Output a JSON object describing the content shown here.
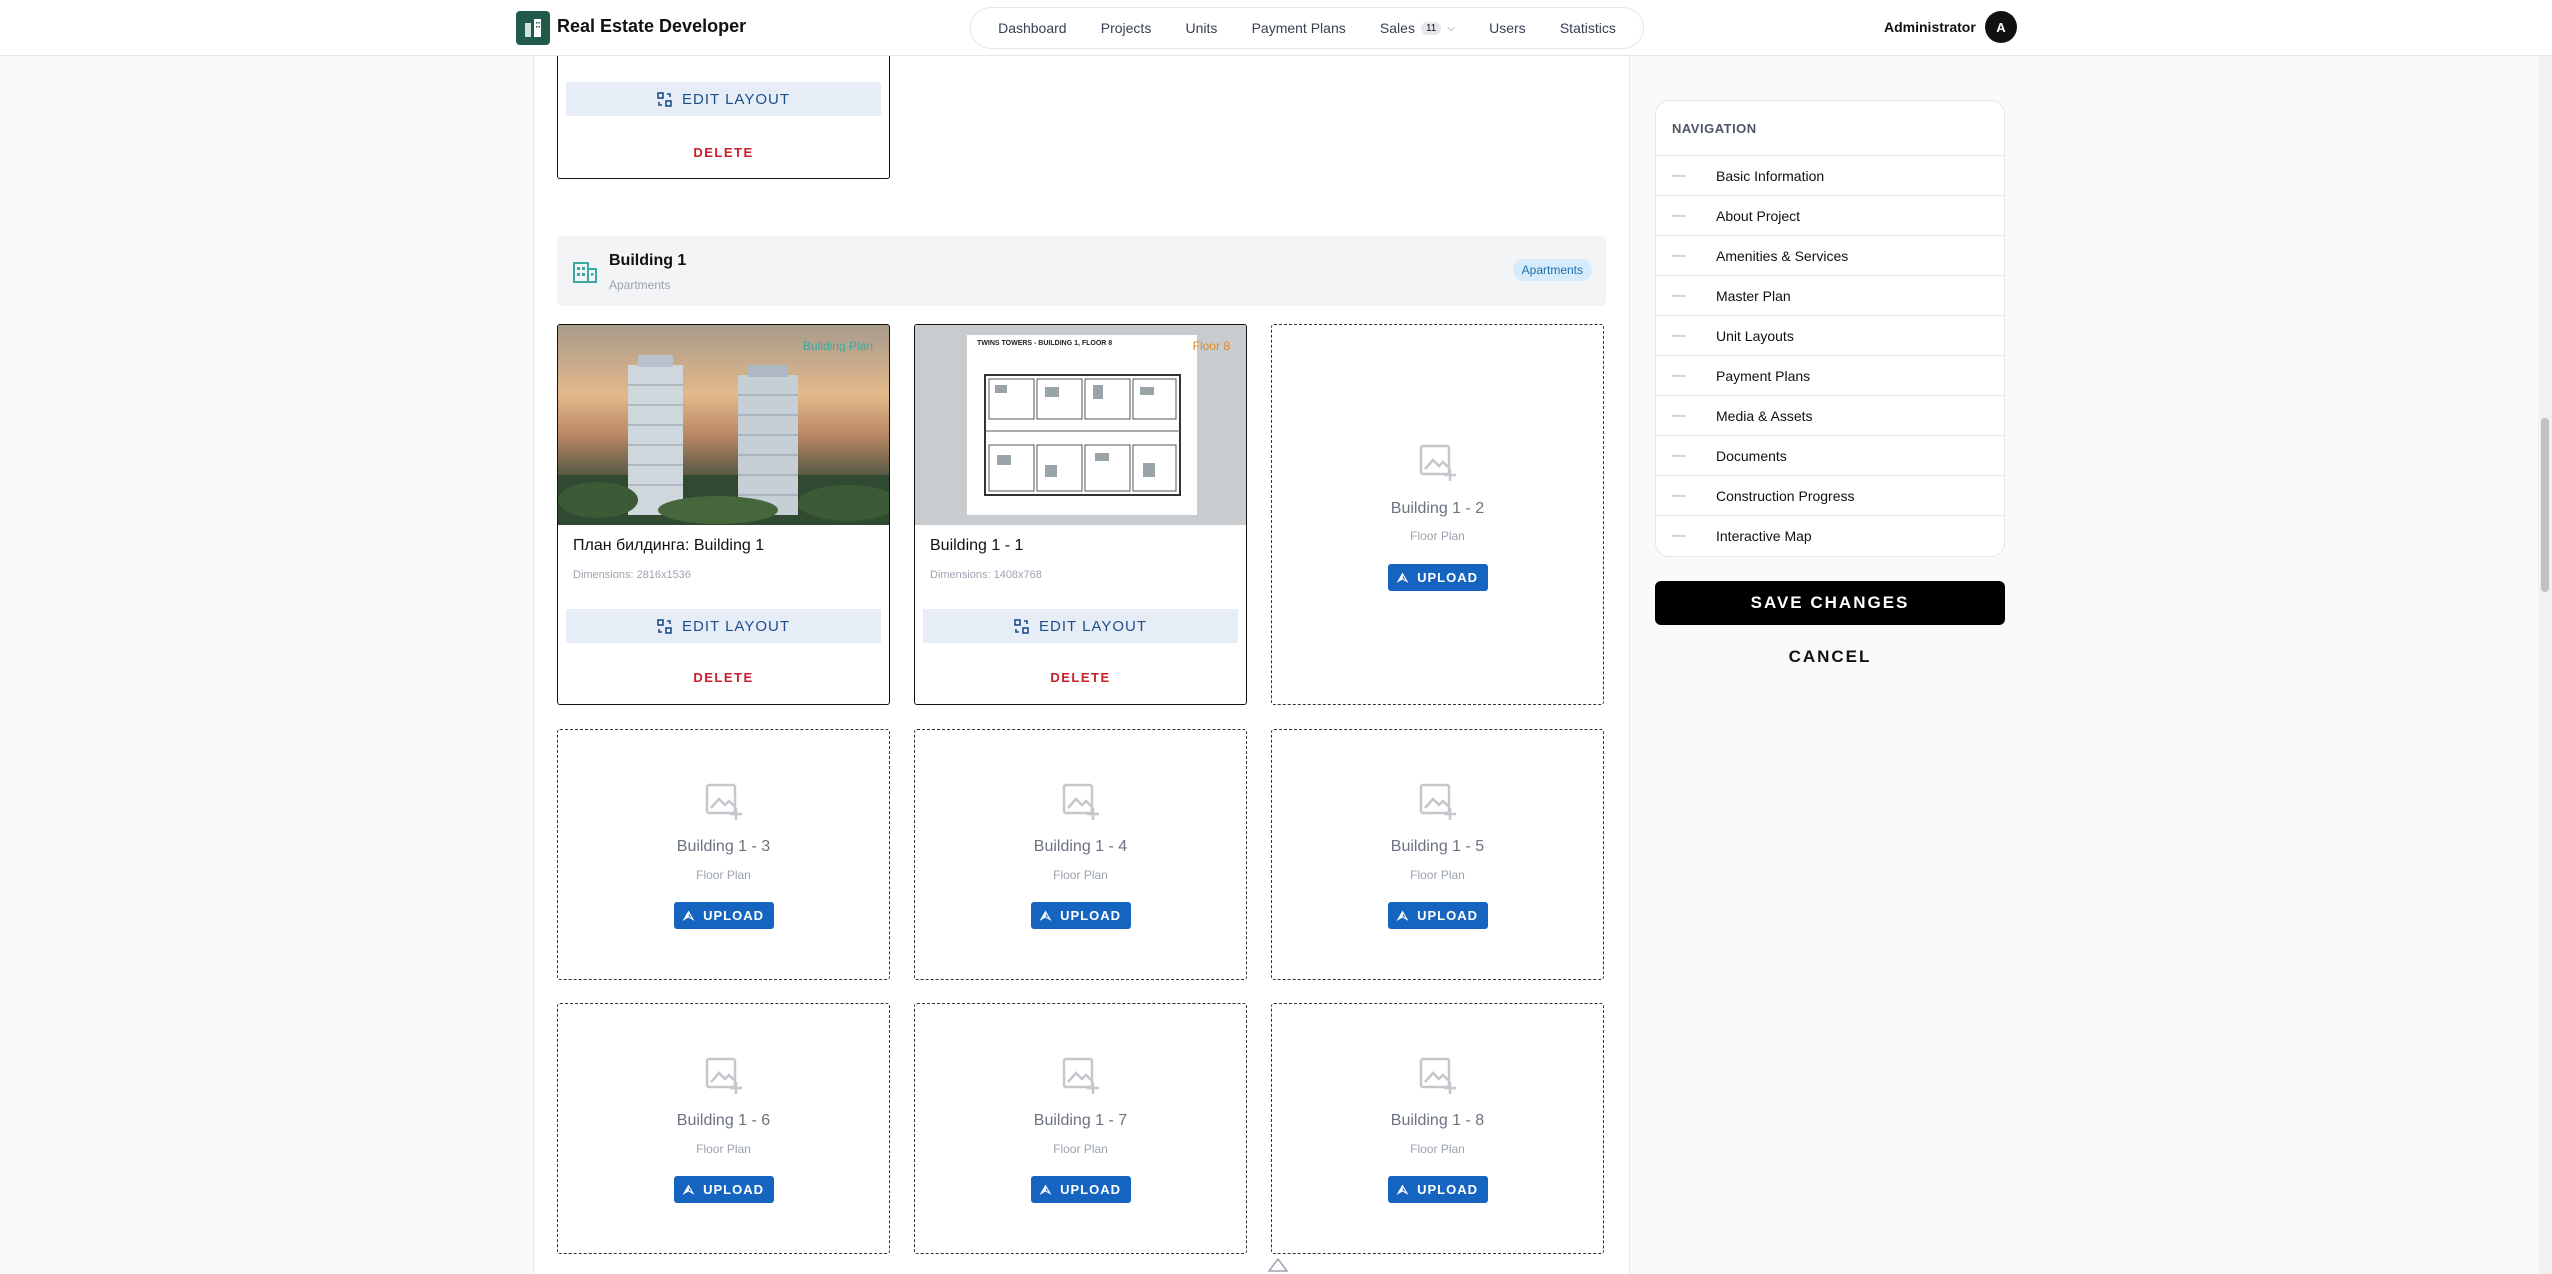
{
  "header": {
    "app_title": "Real Estate Developer",
    "nav": [
      {
        "label": "Dashboard"
      },
      {
        "label": "Projects"
      },
      {
        "label": "Units"
      },
      {
        "label": "Payment Plans"
      },
      {
        "label": "Sales",
        "badge": "11"
      },
      {
        "label": "Users"
      },
      {
        "label": "Statistics"
      }
    ],
    "user_label": "Administrator",
    "avatar_initial": "A"
  },
  "top_card": {
    "edit_label": "EDIT LAYOUT",
    "delete_label": "DELETE"
  },
  "building": {
    "title": "Building 1",
    "subtitle": "Apartments",
    "badge": "Apartments"
  },
  "cards": [
    {
      "name": "План билдинга: Building 1",
      "dimensions": "Dimensions: 2816x1536",
      "tag": "Building Plan",
      "edit_label": "EDIT LAYOUT",
      "delete_label": "DELETE"
    },
    {
      "name": "Building 1 - 1",
      "dimensions": "Dimensions: 1408x768",
      "tag": "Floor 8",
      "image_title": "TWINS TOWERS - BUILDING 1, FLOOR 8",
      "edit_label": "EDIT LAYOUT",
      "delete_label": "DELETE"
    }
  ],
  "slots": [
    {
      "name": "Building 1 - 2",
      "sub": "Floor Plan",
      "button": "UPLOAD"
    },
    {
      "name": "Building 1 - 3",
      "sub": "Floor Plan",
      "button": "UPLOAD"
    },
    {
      "name": "Building 1 - 4",
      "sub": "Floor Plan",
      "button": "UPLOAD"
    },
    {
      "name": "Building 1 - 5",
      "sub": "Floor Plan",
      "button": "UPLOAD"
    },
    {
      "name": "Building 1 - 6",
      "sub": "Floor Plan",
      "button": "UPLOAD"
    },
    {
      "name": "Building 1 - 7",
      "sub": "Floor Plan",
      "button": "UPLOAD"
    },
    {
      "name": "Building 1 - 8",
      "sub": "Floor Plan",
      "button": "UPLOAD"
    }
  ],
  "sidenav": {
    "title": "NAVIGATION",
    "items": [
      {
        "label": "Basic Information"
      },
      {
        "label": "About Project"
      },
      {
        "label": "Amenities & Services"
      },
      {
        "label": "Master Plan"
      },
      {
        "label": "Unit Layouts"
      },
      {
        "label": "Payment Plans"
      },
      {
        "label": "Media & Assets"
      },
      {
        "label": "Documents"
      },
      {
        "label": "Construction Progress"
      },
      {
        "label": "Interactive Map"
      }
    ]
  },
  "actions": {
    "save_label": "SAVE CHANGES",
    "cancel_label": "CANCEL"
  },
  "colors": {
    "accent": "#1565c0",
    "danger": "#c81e2a",
    "badge_bg": "#d6ebfb",
    "building_icon": "#3aa99f"
  }
}
